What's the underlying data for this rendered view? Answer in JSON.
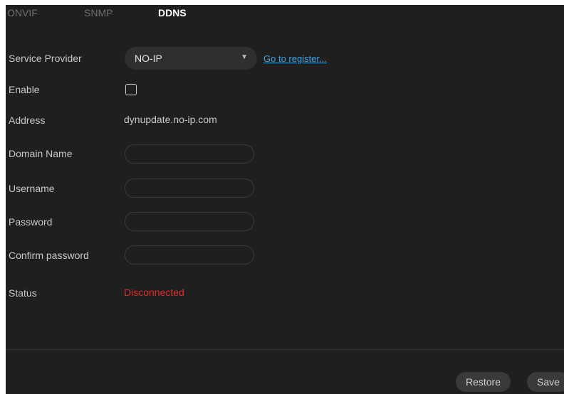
{
  "tabs": [
    {
      "label": "ONVIF",
      "active": false
    },
    {
      "label": "SNMP",
      "active": false
    },
    {
      "label": "DDNS",
      "active": true
    }
  ],
  "form": {
    "service_provider": {
      "label": "Service Provider",
      "value": "NO-IP",
      "register_link": "Go to register..."
    },
    "enable": {
      "label": "Enable",
      "checked": false
    },
    "address": {
      "label": "Address",
      "value": "dynupdate.no-ip.com"
    },
    "domain_name": {
      "label": "Domain Name",
      "value": ""
    },
    "username": {
      "label": "Username",
      "value": ""
    },
    "password": {
      "label": "Password",
      "value": ""
    },
    "confirm_password": {
      "label": "Confirm password",
      "value": ""
    },
    "status": {
      "label": "Status",
      "value": "Disconnected",
      "color": "#e02b2b"
    }
  },
  "footer": {
    "restore_label": "Restore",
    "save_label": "Save"
  },
  "colors": {
    "background": "#1f1f1f",
    "link": "#39a6e6",
    "status_error": "#e02b2b"
  }
}
